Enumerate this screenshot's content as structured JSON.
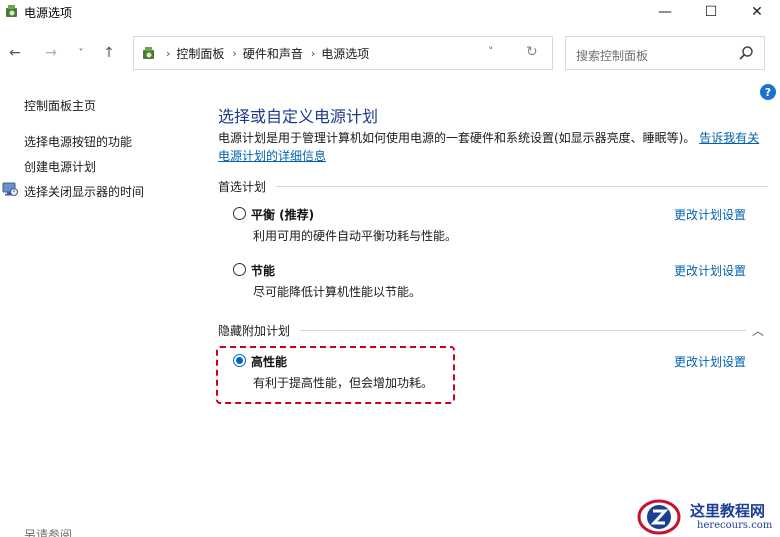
{
  "window": {
    "title": "电源选项",
    "minimize": "—",
    "maximize": "☐",
    "close": "✕"
  },
  "nav": {
    "back": "←",
    "forward": "→",
    "recent": "˅",
    "up": "↑",
    "breadcrumbs": [
      "控制面板",
      "硬件和声音",
      "电源选项"
    ],
    "crumb_separator": "›",
    "dropdown": "˅",
    "refresh": "↻"
  },
  "search": {
    "placeholder": "搜索控制面板"
  },
  "help": "?",
  "sidebar": {
    "home": "控制面板主页",
    "links": [
      "选择电源按钮的功能",
      "创建电源计划",
      "选择关闭显示器的时间"
    ],
    "see_also": "另请参阅"
  },
  "main": {
    "title": "选择或自定义电源计划",
    "description": "电源计划是用于管理计算机如何使用电源的一套硬件和系统设置(如显示器亮度、睡眠等)。",
    "description_link": "告诉我有关电源计划的详细信息",
    "preferred_heading": "首选计划",
    "hidden_heading": "隐藏附加计划",
    "collapse_icon": "︿",
    "change_label": "更改计划设置",
    "plans": [
      {
        "name": "平衡 (推荐)",
        "desc": "利用可用的硬件自动平衡功耗与性能。",
        "selected": false
      },
      {
        "name": "节能",
        "desc": "尽可能降低计算机性能以节能。",
        "selected": false
      },
      {
        "name": "高性能",
        "desc": "有利于提高性能，但会增加功耗。",
        "selected": true
      }
    ]
  },
  "watermark": {
    "title": "这里教程网",
    "url": "herecours.com"
  },
  "colors": {
    "link": "#0063b1",
    "title": "#1e3a8a",
    "highlight": "#d0021b",
    "radio_selected": "#0067c0"
  }
}
